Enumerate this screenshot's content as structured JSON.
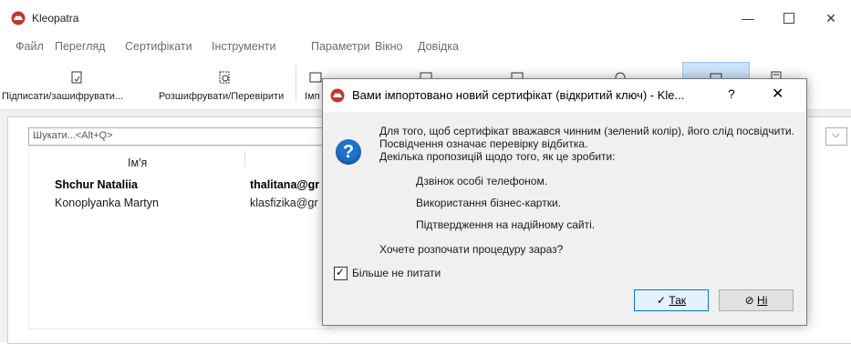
{
  "app": {
    "title": "Kleopatra"
  },
  "menu": [
    "Файл",
    "Перегляд",
    "Сертифікати",
    "Інструменти",
    "Параметри",
    "Вікно",
    "Довідка"
  ],
  "toolbar": {
    "sign_encrypt": "Підписати/зашифрувати...",
    "decrypt_verify": "Розшифрувати/Перевірити",
    "import_short": "Імп"
  },
  "search": {
    "placeholder": "Шукати...<Alt+Q>"
  },
  "certs": {
    "header_name": "Ім'я",
    "rows": [
      {
        "name": "Shchur Nataliia",
        "email": "thalitana@gr"
      },
      {
        "name": "Konoplyanka Martyn",
        "email": "klasfizika@gr"
      }
    ]
  },
  "dialog": {
    "title": "Вами імпортовано новий сертифікат (відкритий ключ) - Kle...",
    "help": "?",
    "close": "✕",
    "line1": "Для того, щоб сертифікат вважався чинним (зелений колір), його слід посвідчити.",
    "line2": "Посвідчення означає перевірку відбитка.",
    "line3": "Декілька пропозицій щодо того, як це зробити:",
    "opt1": "Дзвінок особі телефоном.",
    "opt2": "Використання бізнес-картки.",
    "opt3": "Підтвердження на надійному сайті.",
    "question": "Хочете розпочати процедуру зараз?",
    "checkbox_label": "Більше не питати",
    "checkbox_checked": true,
    "yes_label": "Так",
    "no_label": "Ні"
  },
  "colors": {
    "accent": "#0078d7",
    "question_icon": "#1e73c8",
    "app_icon": "#c0392b"
  }
}
